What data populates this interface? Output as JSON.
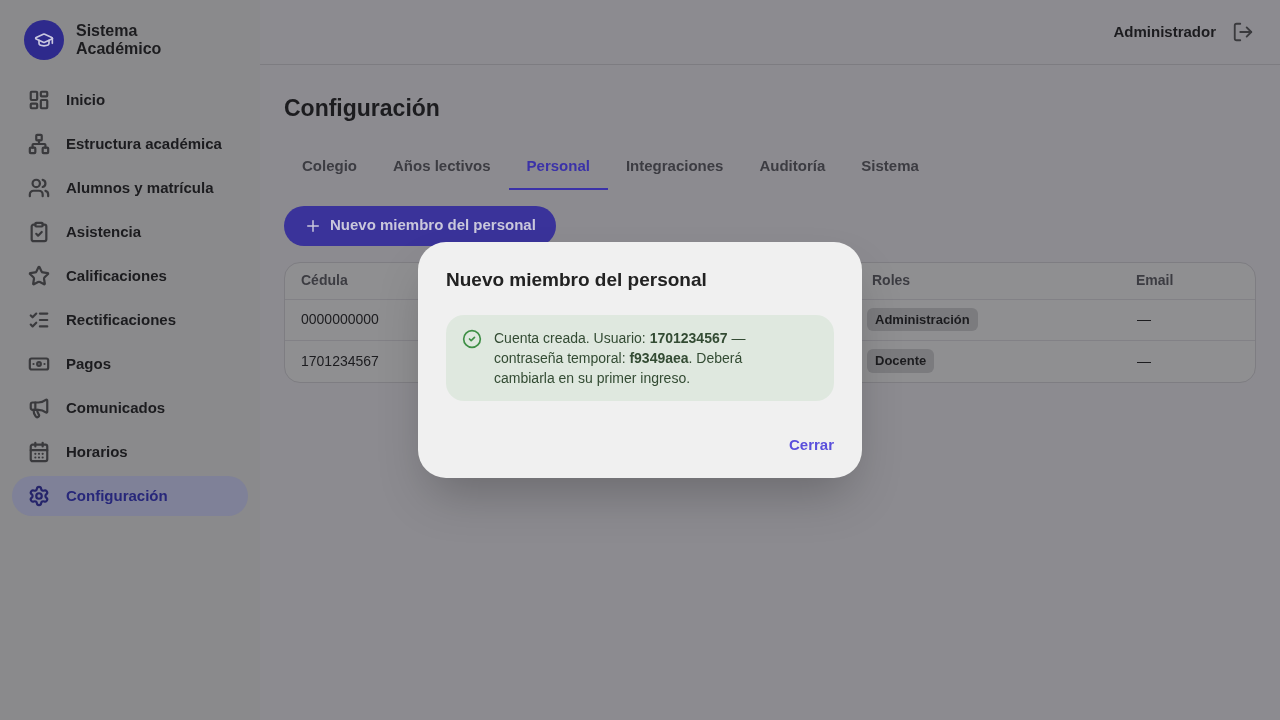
{
  "app": {
    "title": "Sistema Académico"
  },
  "sidebar": {
    "items": [
      {
        "label": "Inicio",
        "selected": false
      },
      {
        "label": "Estructura académica",
        "selected": false
      },
      {
        "label": "Alumnos y matrícula",
        "selected": false
      },
      {
        "label": "Asistencia",
        "selected": false
      },
      {
        "label": "Calificaciones",
        "selected": false
      },
      {
        "label": "Rectificaciones",
        "selected": false
      },
      {
        "label": "Pagos",
        "selected": false
      },
      {
        "label": "Comunicados",
        "selected": false
      },
      {
        "label": "Horarios",
        "selected": false
      },
      {
        "label": "Configuración",
        "selected": true
      }
    ]
  },
  "header": {
    "user": "Administrador"
  },
  "page": {
    "title": "Configuración",
    "tabs": [
      {
        "label": "Colegio",
        "selected": false
      },
      {
        "label": "Años lectivos",
        "selected": false
      },
      {
        "label": "Personal",
        "selected": true
      },
      {
        "label": "Integraciones",
        "selected": false
      },
      {
        "label": "Auditoría",
        "selected": false
      },
      {
        "label": "Sistema",
        "selected": false
      }
    ],
    "new_button": "Nuevo miembro del personal",
    "table": {
      "columns": [
        "Cédula",
        "Roles",
        "Email"
      ],
      "rows": [
        {
          "cedula": "0000000000",
          "role": "Administración",
          "email": "—"
        },
        {
          "cedula": "1701234567",
          "role": "Docente",
          "email": "—"
        }
      ]
    }
  },
  "dialog": {
    "title": "Nuevo miembro del personal",
    "message": "Cuenta creada. Usuario: **1701234567** — contraseña temporal: **f9349aea**. Deberá cambiarla en su primer ingreso.",
    "close": "Cerrar"
  }
}
